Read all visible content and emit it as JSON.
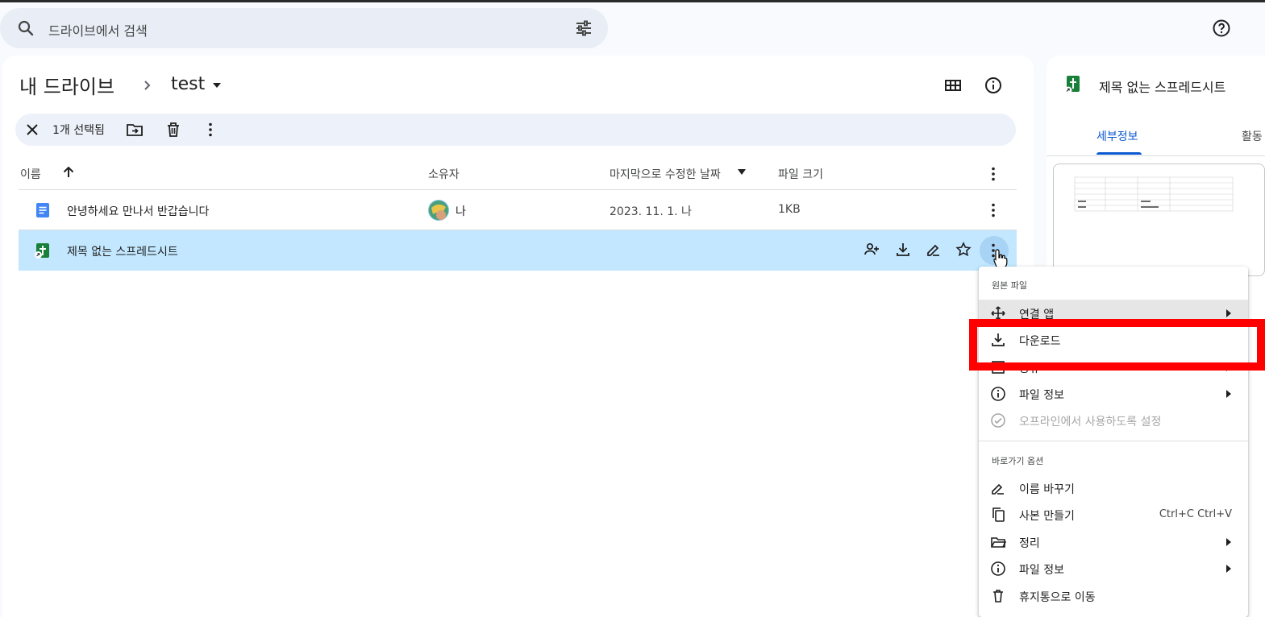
{
  "search": {
    "placeholder": "드라이브에서 검색"
  },
  "breadcrumb": {
    "root": "내 드라이브",
    "current": "test"
  },
  "selection": {
    "count_label": "1개 선택됨"
  },
  "table": {
    "headers": {
      "name": "이름",
      "owner": "소유자",
      "modified": "마지막으로 수정한 날짜",
      "size": "파일 크기"
    },
    "rows": [
      {
        "name": "안녕하세요 만나서 반갑습니다",
        "type": "docs",
        "owner": "나",
        "modified": "2023. 11. 1. 나",
        "size": "1KB"
      },
      {
        "name": "제목 없는 스프레드시트",
        "type": "sheets-shortcut",
        "owner": "",
        "modified": "",
        "size": ""
      }
    ]
  },
  "details_panel": {
    "title": "제목 없는 스프레드시트",
    "tab_details": "세부정보",
    "tab_activity": "활동"
  },
  "context_menu": {
    "section1": "원본 파일",
    "items1": [
      {
        "label": "연결 앱",
        "icon": "move-arrows-icon",
        "submenu": true
      },
      {
        "label": "다운로드",
        "icon": "download-icon",
        "submenu": false
      },
      {
        "label": "공유",
        "icon": "share-icon",
        "submenu": true
      },
      {
        "label": "파일 정보",
        "icon": "info-icon",
        "submenu": true
      },
      {
        "label": "오프라인에서 사용하도록 설정",
        "icon": "offline-icon",
        "submenu": false
      }
    ],
    "section2": "바로가기 옵션",
    "items2": [
      {
        "label": "이름 바꾸기",
        "icon": "rename-icon",
        "submenu": false
      },
      {
        "label": "사본 만들기",
        "icon": "copy-icon",
        "shortcut": "Ctrl+C Ctrl+V"
      },
      {
        "label": "정리",
        "icon": "folder-icon",
        "submenu": true
      },
      {
        "label": "파일 정보",
        "icon": "info-icon",
        "submenu": true
      },
      {
        "label": "휴지통으로 이동",
        "icon": "trash-icon",
        "submenu": false
      }
    ]
  },
  "colors": {
    "accent": "#0b57d0",
    "selected_row": "#c2e7ff",
    "highlight": "#ff0000",
    "sheets_green": "#188038",
    "docs_blue": "#4285f4"
  }
}
